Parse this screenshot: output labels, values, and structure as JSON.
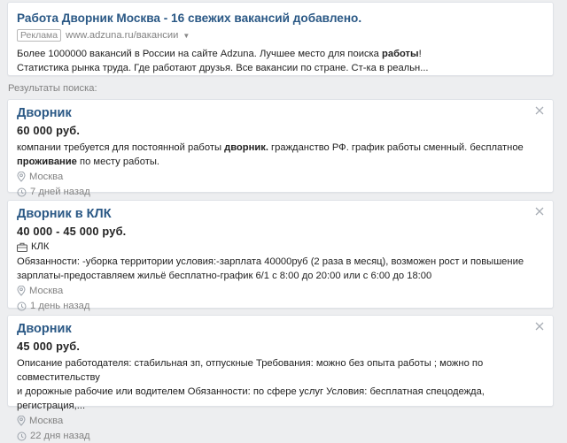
{
  "ad": {
    "title": "Работа Дворник Москва - 16 свежих вакансий добавлено.",
    "badge": "Реклама",
    "url": "www.adzuna.ru/вакансии",
    "text_line1_before": "Более 1000000 вакансий в России на сайте Adzuna. Лучшее место для поиска ",
    "text_line1_bold": "работы",
    "text_line1_after": "!",
    "text_line2": "Статистика рынка труда. Где работают друзья. Все вакансии по стране. Ст-ка в реальн..."
  },
  "results_label": "Результаты поиска:",
  "jobs": [
    {
      "title": "Дворник",
      "salary": "60 000 руб.",
      "desc_p1": "компании требуется для постоянной работы ",
      "desc_b1": "дворник.",
      "desc_p2": " гражданство РФ. график работы сменный. бесплатное ",
      "desc_b2": "проживание",
      "desc_p3": " по месту работы.",
      "location": "Москва",
      "posted": "7 дней назад"
    },
    {
      "title": "Дворник в КЛК",
      "salary": "40 000 - 45 000 руб.",
      "company": "КЛК",
      "desc_line1": "Обязанности: -уборка территории условия:-зарплата 40000руб (2 раза в месяц), возможен рост и повышение",
      "desc_line2": "зарплаты-предоставляем жильё бесплатно-график 6/1 с 8:00 до 20:00 или с 6:00 до 18:00",
      "location": "Москва",
      "posted": "1 день назад"
    },
    {
      "title": "Дворник",
      "salary": "45 000 руб.",
      "desc_line1": "Описание работодателя: стабильная зп, отпускные Требования: можно без опыта работы ; можно по совместительству",
      "desc_line2": "и дорожные рабочие или водителем Обязанности: по сфере услуг Условия: бесплатная спецодежда, регистрация,...",
      "location": "Москва",
      "posted": "22 дня назад"
    }
  ],
  "icons": {
    "location": "location-pin-icon",
    "time": "clock-icon",
    "company": "briefcase-icon",
    "close": "close-icon"
  },
  "colors": {
    "link": "#2a5885",
    "muted": "#828282",
    "background": "#edeef0",
    "card": "#ffffff"
  }
}
